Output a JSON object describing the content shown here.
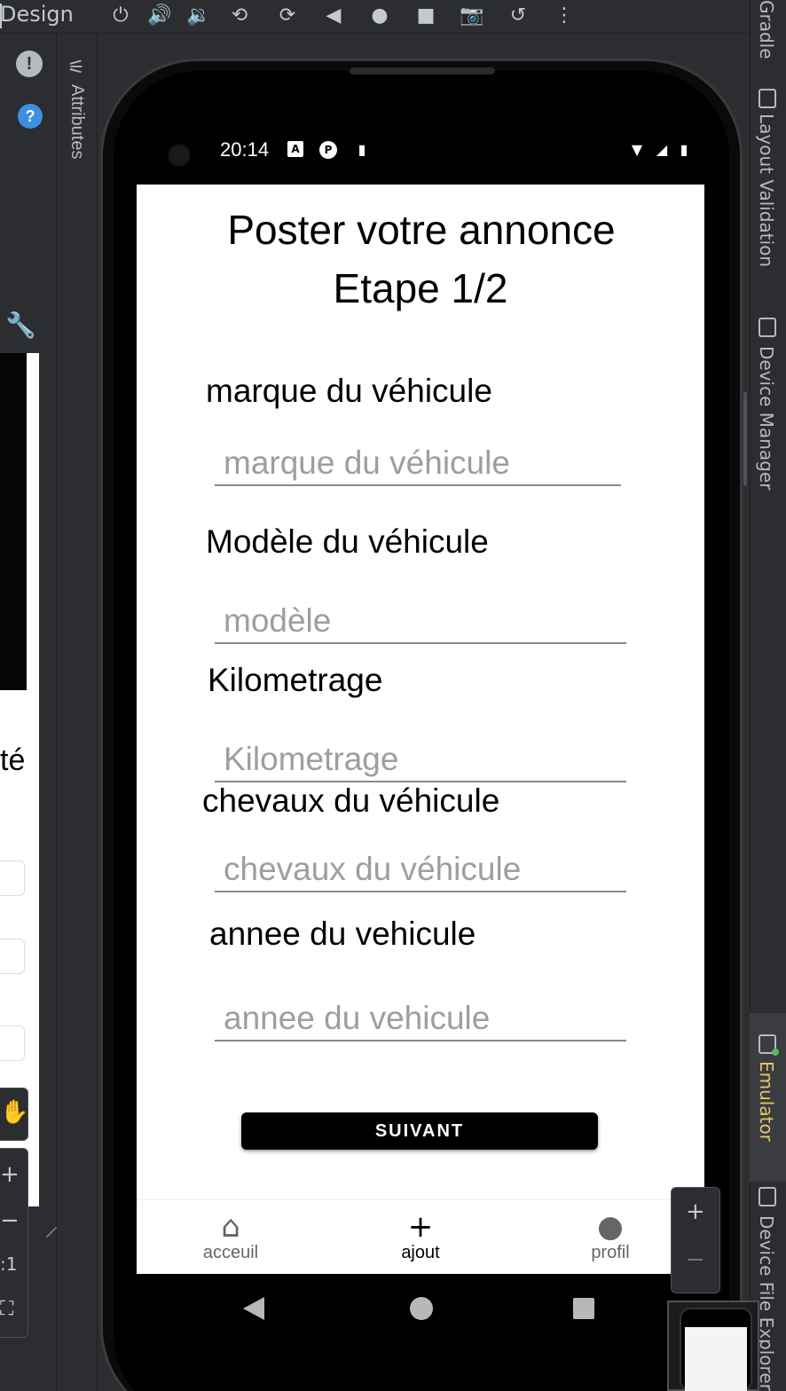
{
  "ide": {
    "mode_label": "Design",
    "attributes_label": "Attributes",
    "toolbar_icons": [
      "power-icon",
      "volume-up-icon",
      "volume-down-icon",
      "rotate-left-icon",
      "rotate-right-icon",
      "back-icon",
      "home-icon",
      "overview-icon",
      "camera-icon",
      "snapshot-icon",
      "more-icon"
    ],
    "right_tools": {
      "gradle": "Gradle",
      "layout_validation": "Layout Validation",
      "device_manager": "Device Manager",
      "emulator": "Emulator",
      "device_file_explorer": "Device File Explorer"
    },
    "preview_fragment_text": "té",
    "accent_color": "#e8c46a"
  },
  "device": {
    "status_time": "20:14"
  },
  "app": {
    "title_line1": "Poster votre annonce",
    "title_line2": "Etape 1/2",
    "fields": [
      {
        "label": "marque du véhicule",
        "placeholder": "marque du véhicule"
      },
      {
        "label": "Modèle du véhicule",
        "placeholder": "modèle"
      },
      {
        "label": "Kilometrage",
        "placeholder": "Kilometrage"
      },
      {
        "label": "chevaux du véhicule",
        "placeholder": "chevaux du véhicule"
      },
      {
        "label": "annee du vehicule",
        "placeholder": "annee du vehicule"
      }
    ],
    "next_button": "SUIVANT",
    "nav": [
      {
        "label": "acceuil",
        "icon": "home-icon"
      },
      {
        "label": "ajout",
        "icon": "plus-icon"
      },
      {
        "label": "profil",
        "icon": "person-icon"
      }
    ]
  }
}
